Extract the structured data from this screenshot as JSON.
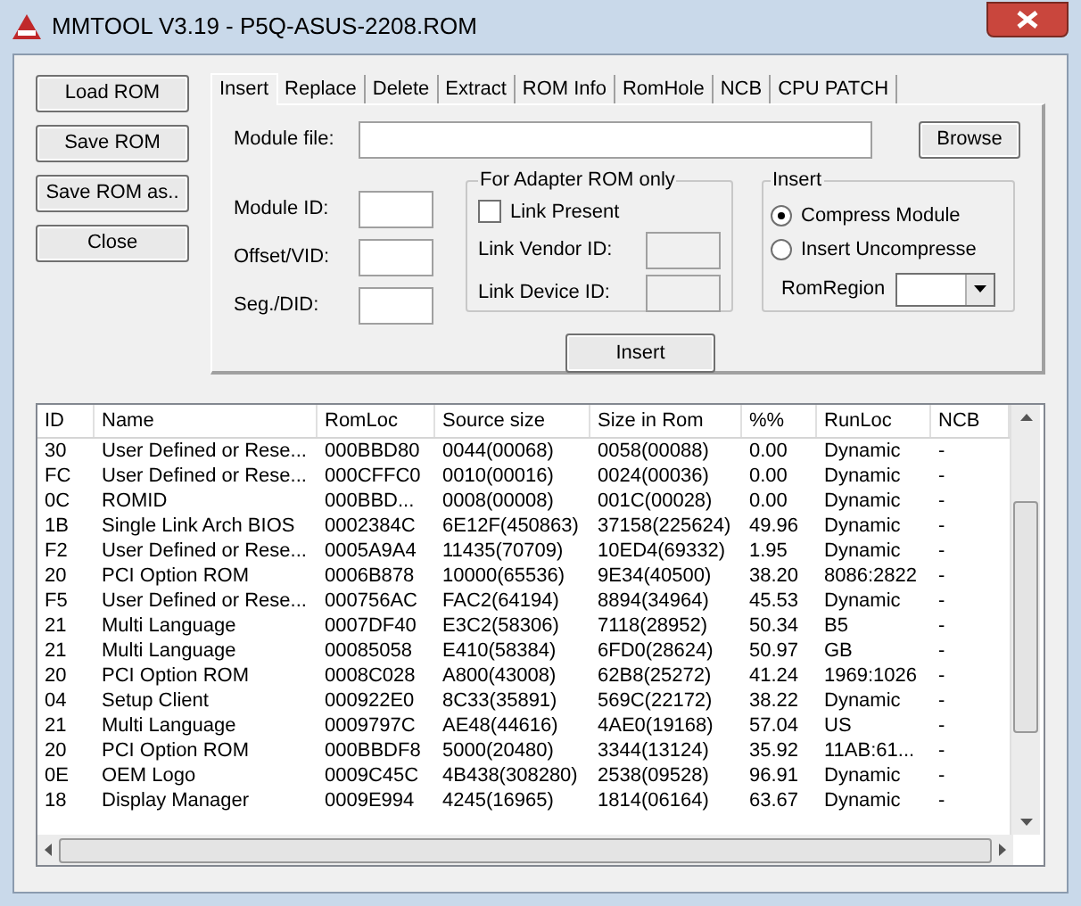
{
  "window": {
    "title": "MMTOOL V3.19 - P5Q-ASUS-2208.ROM"
  },
  "side_buttons": [
    "Load ROM",
    "Save ROM",
    "Save ROM as..",
    "Close"
  ],
  "tabs": [
    {
      "label": "Insert",
      "selected": true
    },
    {
      "label": "Replace",
      "selected": false
    },
    {
      "label": "Delete",
      "selected": false
    },
    {
      "label": "Extract",
      "selected": false
    },
    {
      "label": "ROM Info",
      "selected": false
    },
    {
      "label": "RomHole",
      "selected": false
    },
    {
      "label": "NCB",
      "selected": false
    },
    {
      "label": "CPU PATCH",
      "selected": false
    }
  ],
  "insert_panel": {
    "module_file_label": "Module file:",
    "browse": "Browse",
    "fields": [
      {
        "label": "Module ID:"
      },
      {
        "label": "Offset/VID:"
      },
      {
        "label": "Seg./DID:"
      }
    ],
    "adapter_group": {
      "title": "For Adapter ROM only",
      "link_present": {
        "label": "Link Present",
        "checked": false
      },
      "fields": [
        {
          "label": "Link Vendor ID:",
          "disabled": true
        },
        {
          "label": "Link Device ID:",
          "disabled": true
        }
      ]
    },
    "insert_group": {
      "title": "Insert",
      "options": [
        {
          "label": "Compress Module",
          "selected": true
        },
        {
          "label": "Insert Uncompresse",
          "selected": false
        }
      ],
      "rom_region_label": "RomRegion"
    },
    "insert_button": "Insert"
  },
  "table": {
    "columns": [
      "ID",
      "Name",
      "RomLoc",
      "Source size",
      "Size in Rom",
      "%%",
      "RunLoc",
      "NCB"
    ],
    "rows": [
      [
        "30",
        "User Defined or Rese...",
        "000BBD80",
        "0044(00068)",
        "0058(00088)",
        "0.00",
        "Dynamic",
        "-"
      ],
      [
        "FC",
        "User Defined or Rese...",
        "000CFFC0",
        "0010(00016)",
        "0024(00036)",
        "0.00",
        "Dynamic",
        "-"
      ],
      [
        "0C",
        "ROMID",
        "000BBD...",
        "0008(00008)",
        "001C(00028)",
        "0.00",
        "Dynamic",
        "-"
      ],
      [
        "1B",
        "Single Link Arch BIOS",
        "0002384C",
        "6E12F(450863)",
        "37158(225624)",
        "49.96",
        "Dynamic",
        "-"
      ],
      [
        "F2",
        "User Defined or Rese...",
        "0005A9A4",
        "11435(70709)",
        "10ED4(69332)",
        "1.95",
        "Dynamic",
        "-"
      ],
      [
        "20",
        "PCI Option ROM",
        "0006B878",
        "10000(65536)",
        "9E34(40500)",
        "38.20",
        "8086:2822",
        "-"
      ],
      [
        "F5",
        "User Defined or Rese...",
        "000756AC",
        "FAC2(64194)",
        "8894(34964)",
        "45.53",
        "Dynamic",
        "-"
      ],
      [
        "21",
        "Multi Language",
        "0007DF40",
        "E3C2(58306)",
        "7118(28952)",
        "50.34",
        "B5",
        "-"
      ],
      [
        "21",
        "Multi Language",
        "00085058",
        "E410(58384)",
        "6FD0(28624)",
        "50.97",
        "GB",
        "-"
      ],
      [
        "20",
        "PCI Option ROM",
        "0008C028",
        "A800(43008)",
        "62B8(25272)",
        "41.24",
        "1969:1026",
        "-"
      ],
      [
        "04",
        "Setup Client",
        "000922E0",
        "8C33(35891)",
        "569C(22172)",
        "38.22",
        "Dynamic",
        "-"
      ],
      [
        "21",
        "Multi Language",
        "0009797C",
        "AE48(44616)",
        "4AE0(19168)",
        "57.04",
        "US",
        "-"
      ],
      [
        "20",
        "PCI Option ROM",
        "000BBDF8",
        "5000(20480)",
        "3344(13124)",
        "35.92",
        "11AB:61...",
        "-"
      ],
      [
        "0E",
        "OEM Logo",
        "0009C45C",
        "4B438(308280)",
        "2538(09528)",
        "96.91",
        "Dynamic",
        "-"
      ],
      [
        "18",
        "Display Manager",
        "0009E994",
        "4245(16965)",
        "1814(06164)",
        "63.67",
        "Dynamic",
        "-"
      ]
    ]
  }
}
